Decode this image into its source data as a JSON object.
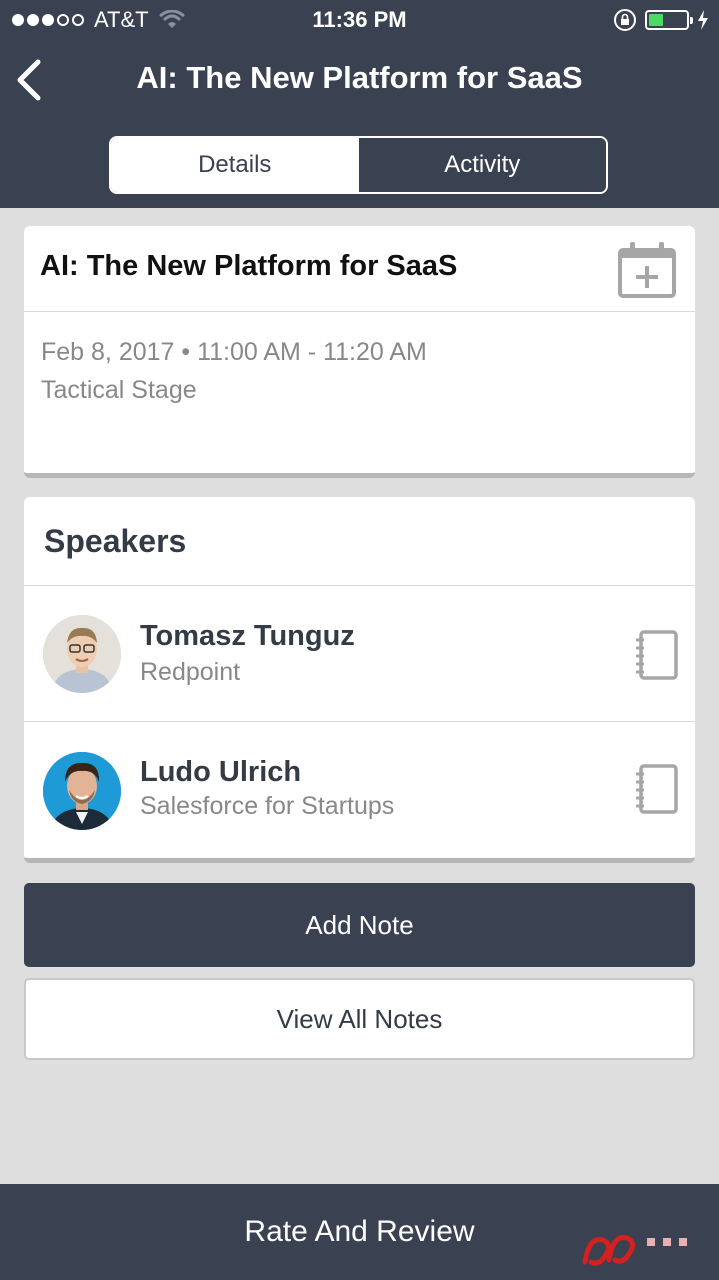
{
  "status_bar": {
    "carrier": "AT&T",
    "time": "11:36 PM",
    "signal_icon": "signal-dots-icon",
    "wifi_icon": "wifi-icon",
    "lock_icon": "rotation-lock-icon",
    "battery_icon": "battery-icon",
    "charging_icon": "charging-bolt-icon"
  },
  "nav": {
    "title": "AI: The New Platform for SaaS",
    "back_icon": "chevron-left-icon",
    "tabs": [
      {
        "label": "Details",
        "active": true
      },
      {
        "label": "Activity",
        "active": false
      }
    ]
  },
  "session": {
    "title": "AI: The New Platform for SaaS",
    "date_time": "Feb 8, 2017 • 11:00 AM - 11:20 AM",
    "location": "Tactical Stage",
    "add_to_calendar_icon": "calendar-plus-icon"
  },
  "speakers": {
    "heading": "Speakers",
    "items": [
      {
        "name": "Tomasz Tunguz",
        "org": "Redpoint",
        "avatar_bg": "#d9d4cc",
        "icon": "notebook-icon"
      },
      {
        "name": "Ludo Ulrich",
        "org": "Salesforce for Startups",
        "avatar_bg": "#1e9ad6",
        "icon": "notebook-icon"
      }
    ]
  },
  "actions": {
    "add_note": "Add Note",
    "view_all_notes": "View All Notes",
    "rate_and_review": "Rate And Review"
  },
  "colors": {
    "brand_dark": "#3a4150",
    "background": "#dedede",
    "battery_green": "#4cd964"
  }
}
